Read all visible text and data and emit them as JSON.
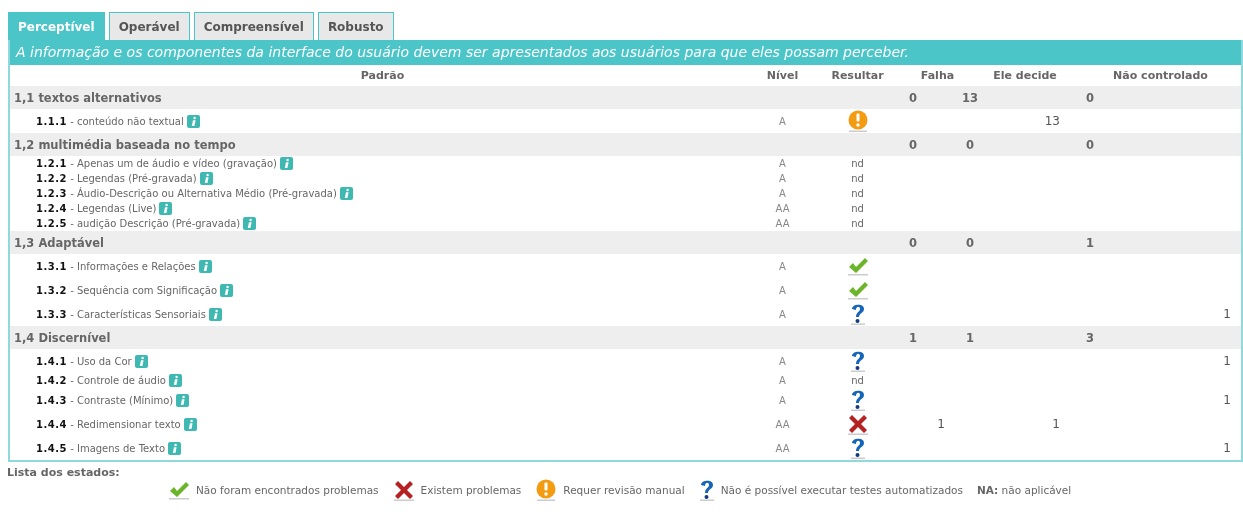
{
  "tabs": [
    {
      "label": "Perceptível",
      "selected": true
    },
    {
      "label": "Operável",
      "selected": false
    },
    {
      "label": "Compreensível",
      "selected": false
    },
    {
      "label": "Robusto",
      "selected": false
    }
  ],
  "description": "A informação e os componentes da interface do usuário devem ser apresentados aos usuários para que eles possam perceber.",
  "table": {
    "columns": [
      "Padrão",
      "Nível",
      "Resultar",
      "Falha",
      "Ele decide",
      "Não controlado"
    ],
    "groups": [
      {
        "title": "1,1 textos alternativos",
        "counts": [
          "0",
          "13",
          "0"
        ],
        "rows": [
          {
            "label": "**1.1.1** - conteúdo não textual",
            "level": "A",
            "kind": "warning",
            "fail": "",
            "decide": "13",
            "unchecked": ""
          }
        ]
      },
      {
        "title": "1,2 multimédia baseada no tempo",
        "counts": [
          "0",
          "0",
          "0"
        ],
        "rows": [
          {
            "label": "**1.2.1** - Apenas um de áudio e vídeo (gravação)",
            "level": "A",
            "kind": "text",
            "result": "nd",
            "fail": "",
            "decide": "",
            "unchecked": ""
          },
          {
            "label": "**1.2.2** - Legendas (Pré-gravada)",
            "level": "A",
            "kind": "text",
            "result": "nd",
            "fail": "",
            "decide": "",
            "unchecked": ""
          },
          {
            "label": "**1.2.3** - Áudio-Descrição ou Alternativa Médio (Pré-gravada)",
            "level": "A",
            "kind": "text",
            "result": "nd",
            "fail": "",
            "decide": "",
            "unchecked": ""
          },
          {
            "label": "**1.2.4** - Legendas (Live)",
            "level": "AA",
            "kind": "text",
            "result": "nd",
            "fail": "",
            "decide": "",
            "unchecked": ""
          },
          {
            "label": "**1.2.5** - audição Descrição (Pré-gravada)",
            "level": "AA",
            "kind": "text",
            "result": "nd",
            "fail": "",
            "decide": "",
            "unchecked": ""
          }
        ]
      },
      {
        "title": "1,3 Adaptável",
        "counts": [
          "0",
          "0",
          "1"
        ],
        "rows": [
          {
            "label": "**1.3.1** - Informações e Relações",
            "level": "A",
            "kind": "pass",
            "fail": "",
            "decide": "",
            "unchecked": ""
          },
          {
            "label": "**1.3.2** - Sequência com Significação",
            "level": "A",
            "kind": "pass",
            "fail": "",
            "decide": "",
            "unchecked": ""
          },
          {
            "label": "**1.3.3** - Características Sensoriais",
            "level": "A",
            "kind": "unknown",
            "fail": "",
            "decide": "",
            "unchecked": "1"
          }
        ]
      },
      {
        "title": "1,4 Discernível",
        "counts": [
          "1",
          "1",
          "3"
        ],
        "rows": [
          {
            "label": "**1.4.1** - Uso da Cor",
            "level": "A",
            "kind": "unknown",
            "fail": "",
            "decide": "",
            "unchecked": "1"
          },
          {
            "label": "**1.4.2** - Controle de áudio",
            "level": "A",
            "kind": "text",
            "result": "nd",
            "fail": "",
            "decide": "",
            "unchecked": ""
          },
          {
            "label": "**1.4.3** - Contraste (Mínimo)",
            "level": "A",
            "kind": "unknown",
            "fail": "",
            "decide": "",
            "unchecked": "1"
          },
          {
            "label": "**1.4.4** - Redimensionar texto",
            "level": "AA",
            "kind": "fail",
            "fail": "1",
            "decide": "1",
            "unchecked": ""
          },
          {
            "label": "**1.4.5** - Imagens de Texto",
            "level": "AA",
            "kind": "unknown",
            "fail": "",
            "decide": "",
            "unchecked": "1"
          }
        ]
      }
    ]
  },
  "legend": {
    "title": "Lista dos estados:",
    "items": [
      {
        "kind": "pass",
        "label": "Não foram encontrados problemas"
      },
      {
        "kind": "fail",
        "label": "Existem problemas"
      },
      {
        "kind": "warning",
        "label": "Requer revisão manual"
      },
      {
        "kind": "unknown",
        "label": "Não é possível executar testes automatizados"
      },
      {
        "kind": "text",
        "label": "**NA:** não aplicável"
      }
    ]
  }
}
